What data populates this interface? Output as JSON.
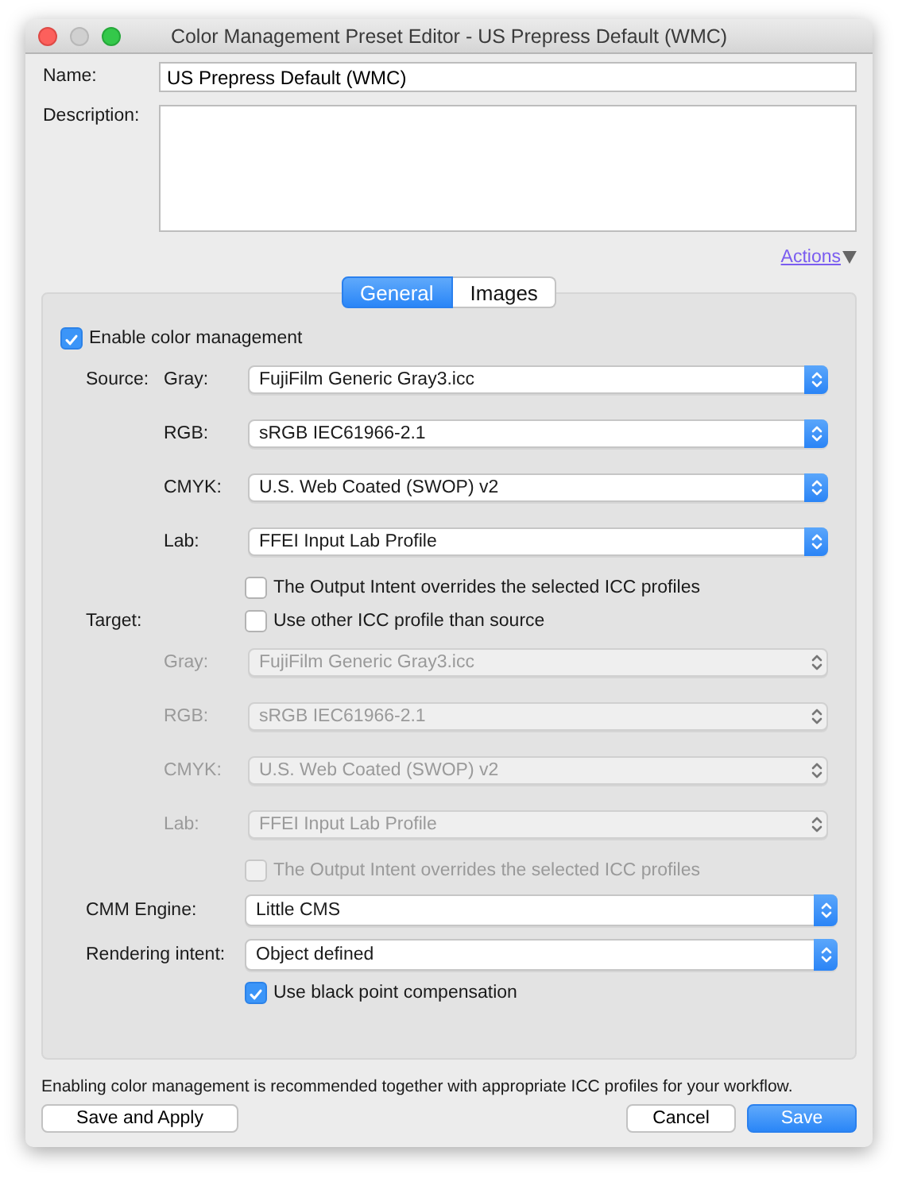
{
  "window": {
    "title": "Color Management Preset Editor - US Prepress Default (WMC)"
  },
  "name": {
    "label": "Name:",
    "value": "US Prepress Default (WMC)"
  },
  "description": {
    "label": "Description:"
  },
  "actions": {
    "label": "Actions"
  },
  "tabs": [
    {
      "label": "General",
      "selected": true
    },
    {
      "label": "Images",
      "selected": false
    }
  ],
  "enable": {
    "label": "Enable color management",
    "checked": true
  },
  "source": {
    "label": "Source:",
    "profiles": [
      {
        "label": "Gray:",
        "value": "FujiFilm Generic Gray3.icc",
        "disabled": false
      },
      {
        "label": "RGB:",
        "value": "sRGB IEC61966-2.1",
        "disabled": false
      },
      {
        "label": "CMYK:",
        "value": "U.S. Web Coated (SWOP) v2",
        "disabled": false
      },
      {
        "label": "Lab:",
        "value": "FFEI Input Lab Profile",
        "disabled": false
      }
    ],
    "output_intent": {
      "label": "The Output Intent overrides the selected ICC profiles",
      "checked": false,
      "disabled": false
    }
  },
  "target": {
    "label": "Target:",
    "use_other": {
      "label": "Use other ICC profile than source",
      "checked": false
    },
    "profiles": [
      {
        "label": "Gray:",
        "value": "FujiFilm Generic Gray3.icc",
        "disabled": true
      },
      {
        "label": "RGB:",
        "value": "sRGB IEC61966-2.1",
        "disabled": true
      },
      {
        "label": "CMYK:",
        "value": "U.S. Web Coated (SWOP) v2",
        "disabled": true
      },
      {
        "label": "Lab:",
        "value": "FFEI Input Lab Profile",
        "disabled": true
      }
    ],
    "output_intent": {
      "label": "The Output Intent overrides the selected ICC profiles",
      "checked": false,
      "disabled": true
    }
  },
  "cmm_engine": {
    "label": "CMM Engine:",
    "value": "Little CMS"
  },
  "rendering_intent": {
    "label": "Rendering intent:",
    "value": "Object defined"
  },
  "black_point": {
    "label": "Use black point compensation",
    "checked": true
  },
  "note": "Enabling color management is recommended together with appropriate ICC profiles for your workflow.",
  "buttons_left": [
    {
      "label": "Save and Apply",
      "primary": false
    }
  ],
  "buttons_right": [
    {
      "label": "Cancel",
      "primary": false
    },
    {
      "label": "Save",
      "primary": true
    }
  ]
}
